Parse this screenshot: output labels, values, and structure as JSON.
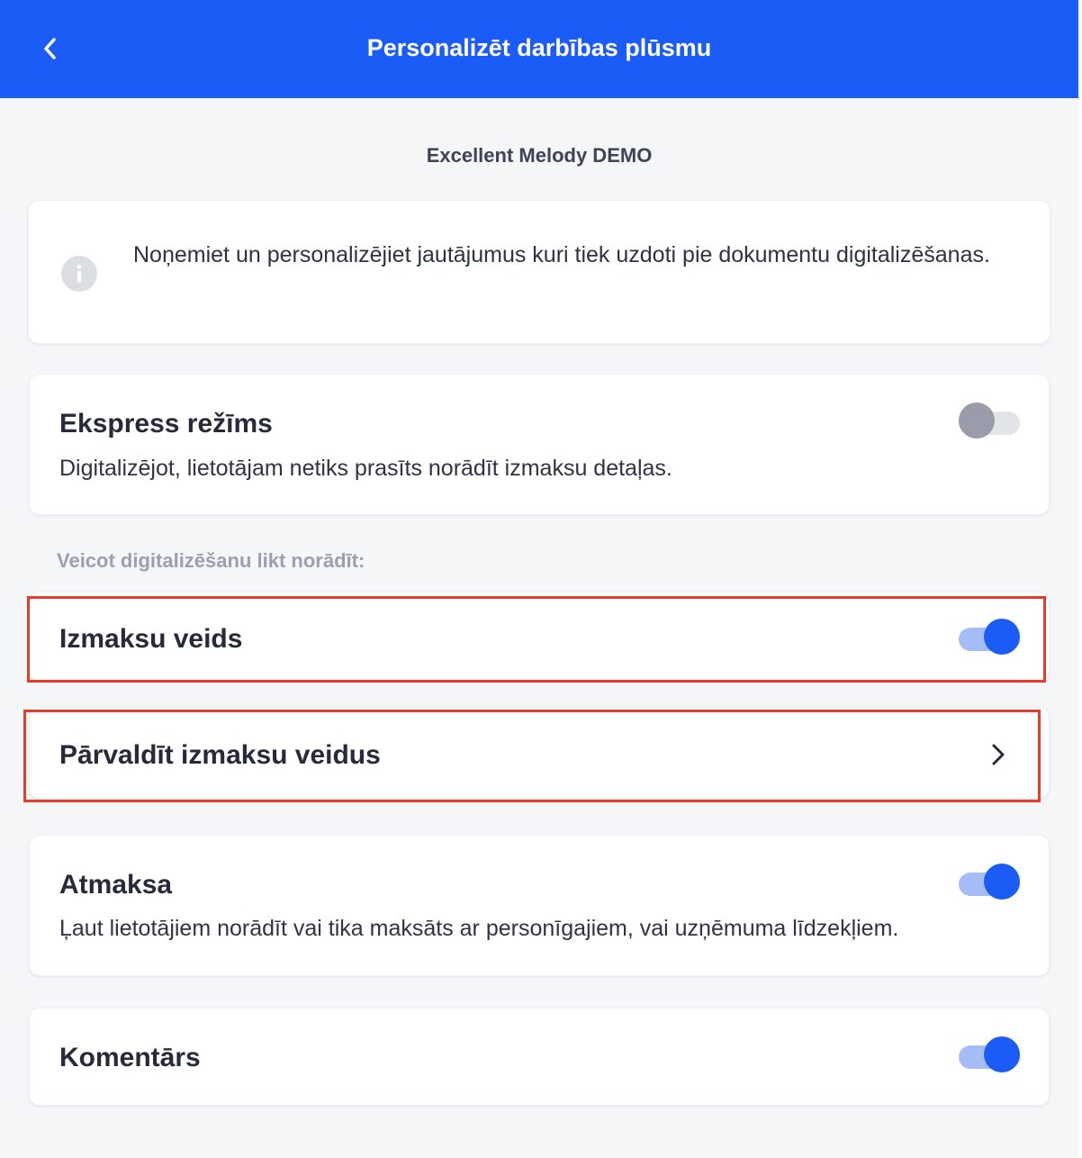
{
  "header": {
    "title": "Personalizēt darbības plūsmu",
    "back_icon": "chevron-left-icon",
    "background": "#1a5cf5"
  },
  "company_name": "Excellent Melody DEMO",
  "info": {
    "icon": "info-icon",
    "text": "Noņemiet un personalizējiet jautājumus kuri tiek uzdoti pie dokumentu digitalizēšanas."
  },
  "express_mode": {
    "title": "Ekspress režīms",
    "description": "Digitalizējot, lietotājam netiks prasīts norādīt izmaksu detaļas.",
    "enabled": false
  },
  "section_label": "Veicot digitalizēšanu likt norādīt:",
  "expense_type": {
    "title": "Izmaksu veids",
    "enabled": true
  },
  "manage_expense_types": {
    "title": "Pārvaldīt izmaksu veidus",
    "icon": "chevron-right-icon"
  },
  "refund": {
    "title": "Atmaksa",
    "description": "Ļaut lietotājiem norādīt vai tika maksāts ar personīgajiem, vai uzņēmuma līdzekļiem.",
    "enabled": true
  },
  "comment": {
    "title": "Komentārs",
    "enabled": true
  },
  "colors": {
    "accent": "#1a5cf5",
    "highlight": "#e53c2c",
    "background": "#f5f6f8"
  }
}
